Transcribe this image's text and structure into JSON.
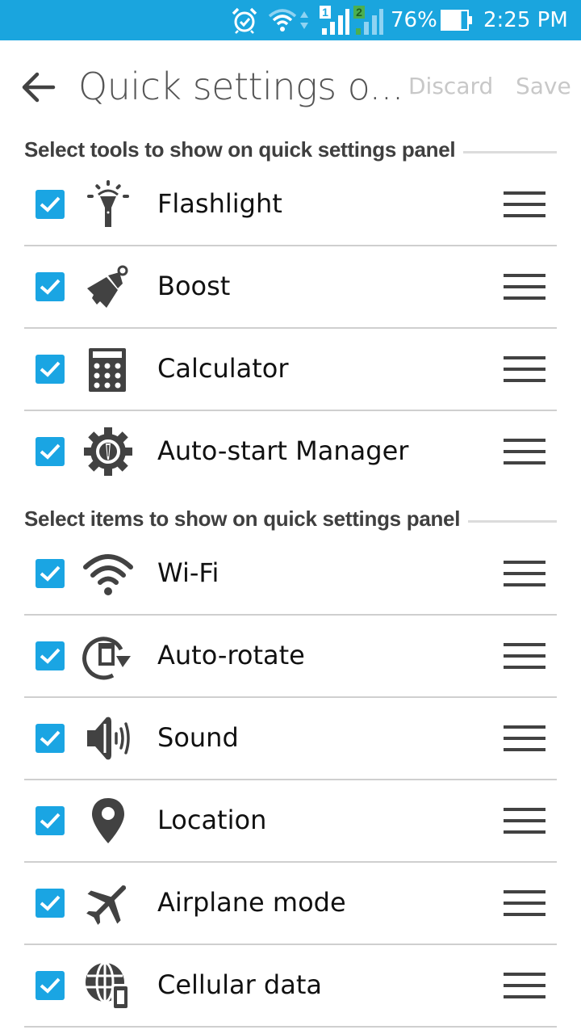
{
  "status_bar": {
    "battery_percent_label": "76%",
    "battery_level": 0.76,
    "time": "2:25 PM",
    "sim1_label": "1",
    "sim2_label": "2",
    "icons": [
      "alarm-icon",
      "wifi-icon",
      "data-activity-icon",
      "signal-sim1-icon",
      "signal-sim2-icon",
      "battery-icon"
    ],
    "background_color": "#1aa5de"
  },
  "app_bar": {
    "title": "Quick settings o...",
    "discard_label": "Discard",
    "save_label": "Save",
    "back_icon": "arrow-left-icon"
  },
  "accent_color": "#1aa5e3",
  "sections": [
    {
      "header": "Select tools to show on quick settings panel",
      "items": [
        {
          "label": "Flashlight",
          "icon": "flashlight-icon",
          "checked": true
        },
        {
          "label": "Boost",
          "icon": "broom-icon",
          "checked": true
        },
        {
          "label": "Calculator",
          "icon": "calculator-icon",
          "checked": true
        },
        {
          "label": "Auto-start Manager",
          "icon": "gear-power-icon",
          "checked": true
        }
      ]
    },
    {
      "header": "Select items to show on quick settings panel",
      "items": [
        {
          "label": "Wi-Fi",
          "icon": "wifi-icon",
          "checked": true
        },
        {
          "label": "Auto-rotate",
          "icon": "auto-rotate-icon",
          "checked": true
        },
        {
          "label": "Sound",
          "icon": "speaker-icon",
          "checked": true
        },
        {
          "label": "Location",
          "icon": "location-pin-icon",
          "checked": true
        },
        {
          "label": "Airplane mode",
          "icon": "airplane-icon",
          "checked": true
        },
        {
          "label": "Cellular data",
          "icon": "globe-phone-icon",
          "checked": true
        }
      ]
    }
  ]
}
